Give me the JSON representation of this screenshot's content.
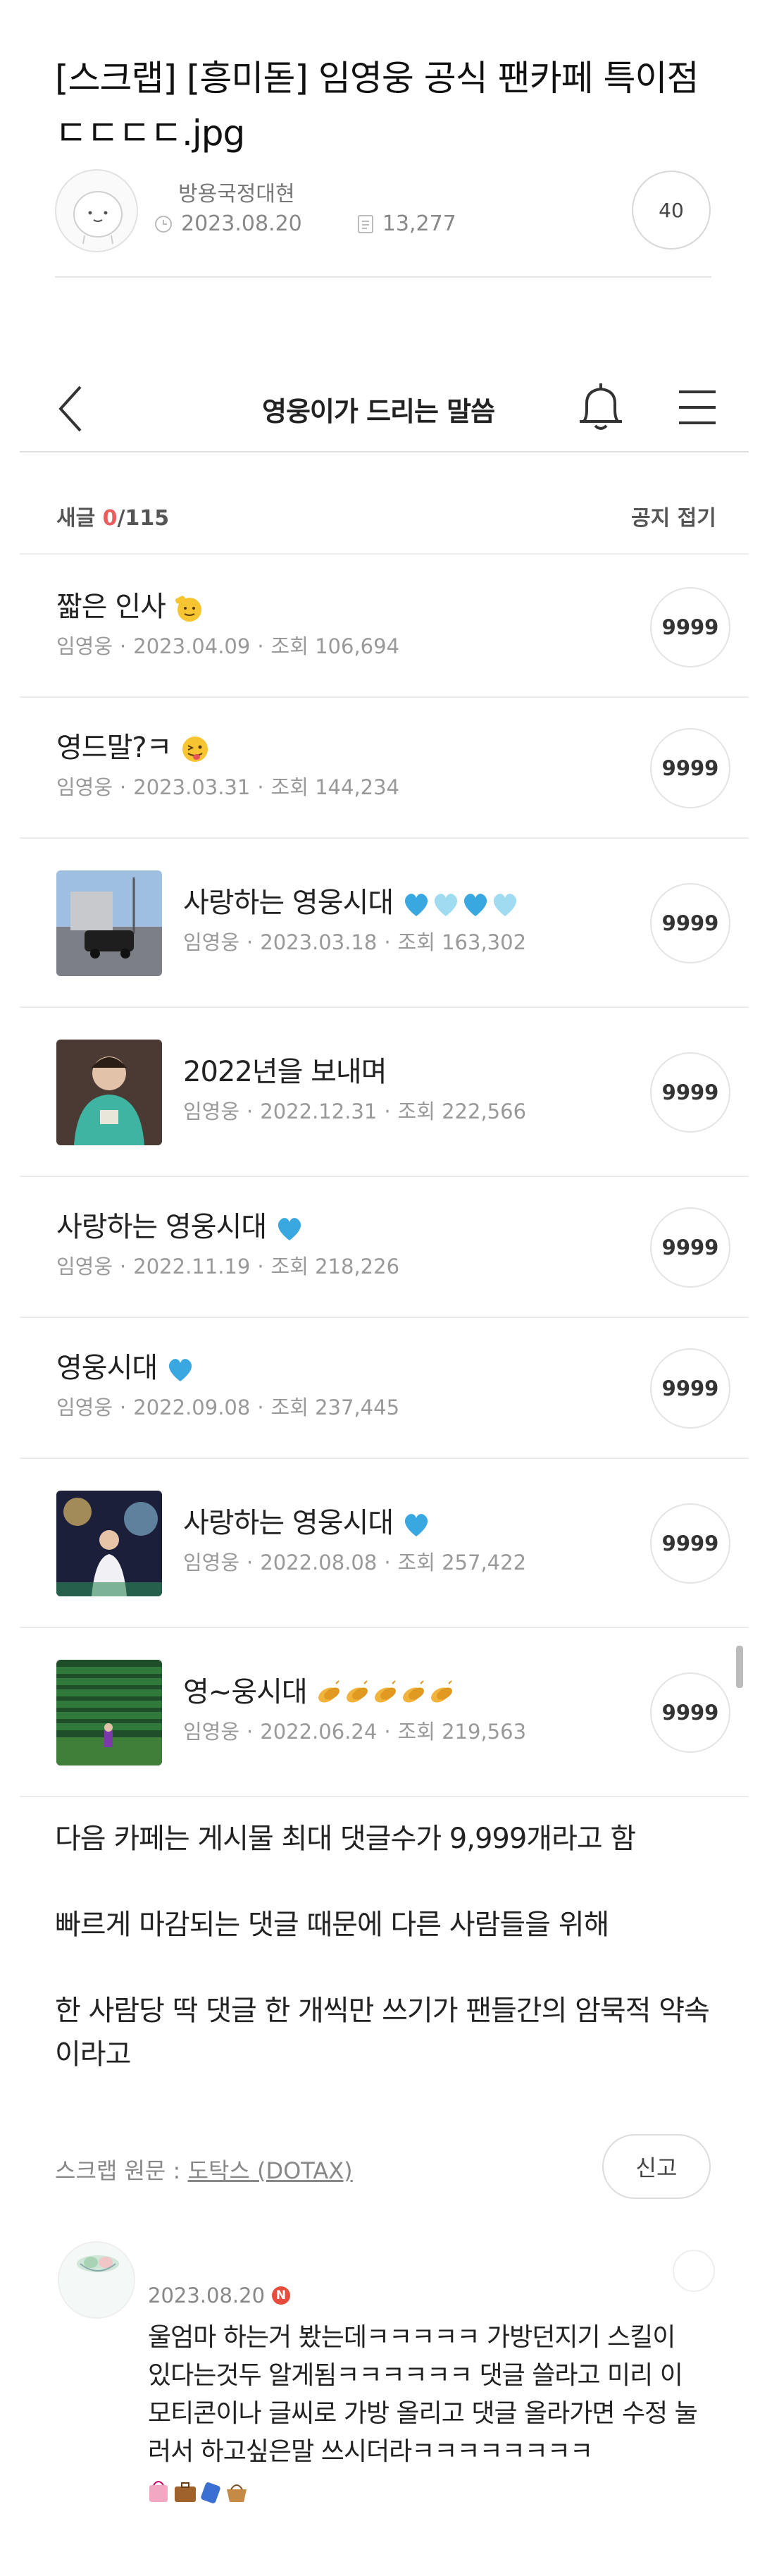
{
  "post": {
    "title": "[스크랩] [흥미돋] 임영웅 공식 팬카페 특이점ㄷㄷㄷㄷ.jpg",
    "author": "방용국정대현",
    "date": "2023.08.20",
    "views": "13,277",
    "comment_count": "40"
  },
  "embedded": {
    "header_title": "영웅이가 드리는 말씀",
    "new_label": "새글",
    "new_count": "0",
    "total": "/115",
    "notice_fold": "공지 접기",
    "posts": [
      {
        "title": "짧은 인사",
        "emoji": "salute",
        "author": "임영웅",
        "date": "2023.04.09",
        "views": "조회 106,694",
        "count": "9999",
        "thumb": null
      },
      {
        "title": "영드말?ㅋ",
        "emoji": "tongue",
        "author": "임영웅",
        "date": "2023.03.31",
        "views": "조회 144,234",
        "count": "9999",
        "thumb": null
      },
      {
        "title": "사랑하는 영웅시대",
        "emoji": "hearts4",
        "author": "임영웅",
        "date": "2023.03.18",
        "views": "조회 163,302",
        "count": "9999",
        "thumb": "car"
      },
      {
        "title": "2022년을 보내며",
        "emoji": "",
        "author": "임영웅",
        "date": "2022.12.31",
        "views": "조회 222,566",
        "count": "9999",
        "thumb": "person"
      },
      {
        "title": "사랑하는 영웅시대",
        "emoji": "heart",
        "author": "임영웅",
        "date": "2022.11.19",
        "views": "조회 218,226",
        "count": "9999",
        "thumb": null
      },
      {
        "title": "영웅시대",
        "emoji": "heart",
        "author": "임영웅",
        "date": "2022.09.08",
        "views": "조회 237,445",
        "count": "9999",
        "thumb": null
      },
      {
        "title": "사랑하는 영웅시대",
        "emoji": "heart",
        "author": "임영웅",
        "date": "2022.08.08",
        "views": "조회 257,422",
        "count": "9999",
        "thumb": "stage"
      },
      {
        "title": "영~웅시대",
        "emoji": "clap5",
        "author": "임영웅",
        "date": "2022.06.24",
        "views": "조회 219,563",
        "count": "9999",
        "thumb": "field"
      }
    ]
  },
  "body": {
    "p1": "다음 카페는 게시물 최대 댓글수가 9,999개라고 함",
    "p2": "빠르게 마감되는 댓글 때문에 다른 사람들을 위해",
    "p3": "한 사람당 딱 댓글 한 개씩만 쓰기가 팬들간의 암묵적 약속이라고"
  },
  "source": {
    "label": "스크랩 원문 : ",
    "link": "도탁스 (DOTAX)"
  },
  "report_label": "신고",
  "comment": {
    "date": "2023.08.20",
    "badge": "N",
    "text": "울엄마 하는거 봤는데ㅋㅋㅋㅋㅋ 가방던지기 스킬이 있다는것두 알게됨ㅋㅋㅋㅋㅋㅋ 댓글 쓸라고 미리 이모티콘이나 글씨로 가방 올리고 댓글 올라가면 수정 눌러서 하고싶은말 쓰시더라ㅋㅋㅋㅋㅋㅋㅋㅋ"
  },
  "colors": {
    "accent_red": "#e85d5d",
    "heart_blue": "#3aa8e0",
    "heart_light": "#9fdcf2"
  }
}
